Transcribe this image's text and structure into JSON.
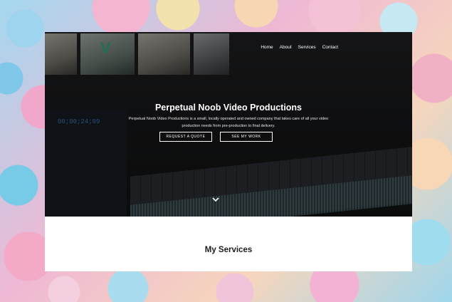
{
  "nav": {
    "items": [
      "Home",
      "About",
      "Services",
      "Contact"
    ]
  },
  "hero": {
    "title": "Perpetual Noob Video Productions",
    "description": "Perpetual Noob Video Productions is a small, locally operated and owned company that takes care of all your video production needs from pre-production to final delivery.",
    "buttons": {
      "quote": "REQUEST A QUOTE",
      "work": "SEE MY WORK"
    },
    "timecode": "00;00;24;09",
    "chevron_icon": "chevron-down-icon"
  },
  "services": {
    "title": "My Services"
  },
  "colors": {
    "hero_bg": "#1c1d1f",
    "accent_logo": "#3ec89a",
    "timecode": "#4a8fd8"
  }
}
